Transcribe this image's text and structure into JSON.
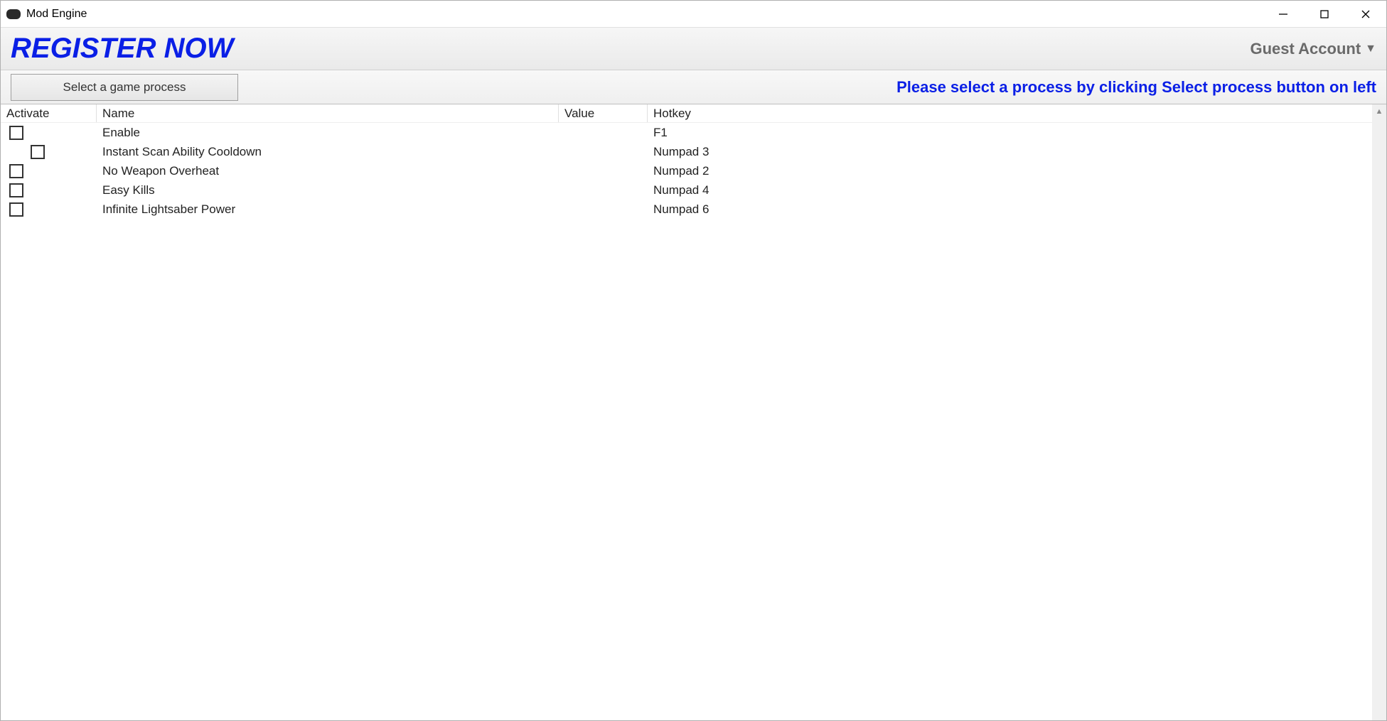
{
  "window": {
    "title": "Mod Engine"
  },
  "topbar": {
    "register_label": "REGISTER NOW",
    "account_label": "Guest Account"
  },
  "actionbar": {
    "select_process_label": "Select a game process",
    "instruction": "Please select a process by clicking Select process button on left"
  },
  "table": {
    "headers": {
      "activate": "Activate",
      "name": "Name",
      "value": "Value",
      "hotkey": "Hotkey"
    },
    "rows": [
      {
        "indented": false,
        "name": "Enable",
        "value": "",
        "hotkey": "F1"
      },
      {
        "indented": true,
        "name": "Instant Scan Ability Cooldown",
        "value": "",
        "hotkey": "Numpad 3"
      },
      {
        "indented": false,
        "name": "No Weapon Overheat",
        "value": "",
        "hotkey": "Numpad 2"
      },
      {
        "indented": false,
        "name": "Easy Kills",
        "value": "",
        "hotkey": "Numpad 4"
      },
      {
        "indented": false,
        "name": "Infinite Lightsaber Power",
        "value": "",
        "hotkey": "Numpad 6"
      }
    ]
  }
}
